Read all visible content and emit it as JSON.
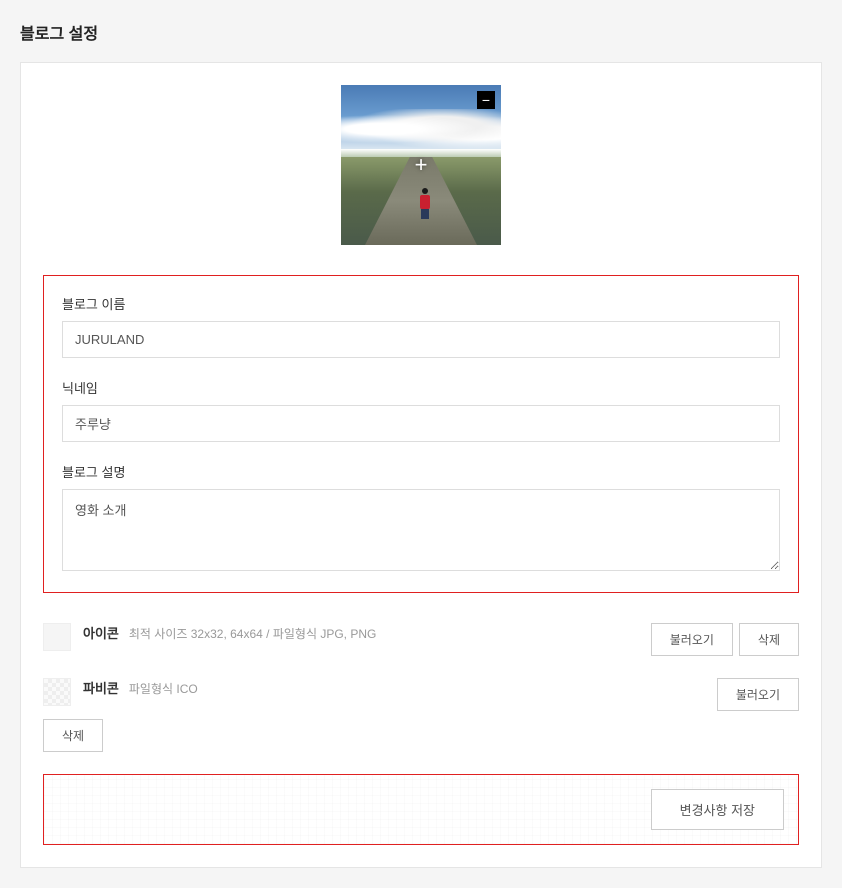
{
  "page": {
    "title": "블로그 설정"
  },
  "cover": {
    "remove_glyph": "−",
    "add_glyph": "+"
  },
  "form": {
    "blog_name": {
      "label": "블로그 이름",
      "value": "JURULAND"
    },
    "nickname": {
      "label": "닉네임",
      "value": "주루냥"
    },
    "description": {
      "label": "블로그 설명",
      "value": "영화 소개"
    }
  },
  "assets": {
    "icon": {
      "label": "아이콘",
      "hint": "최적 사이즈 32x32, 64x64 / 파일형식 JPG, PNG",
      "load_label": "불러오기",
      "delete_label": "삭제"
    },
    "favicon": {
      "label": "파비콘",
      "hint": "파일형식 ICO",
      "load_label": "불러오기",
      "delete_label": "삭제"
    }
  },
  "actions": {
    "save_label": "변경사항 저장"
  }
}
